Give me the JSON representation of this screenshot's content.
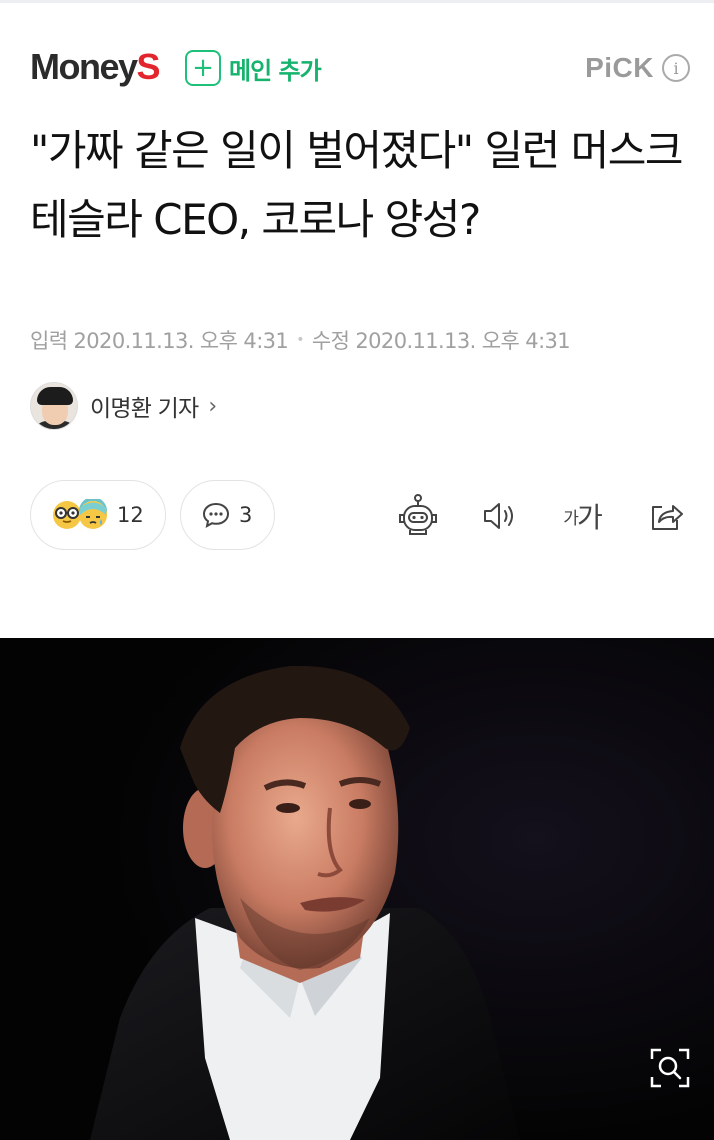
{
  "header": {
    "press_name_main": "Money",
    "press_name_accent": "S",
    "subscribe_label": "메인 추가",
    "subscribe_icon": "plus-icon",
    "pick_label": "PiCK",
    "pick_info_symbol": "i",
    "accent_color": "#1ec07a",
    "brand_color": "#e3262d"
  },
  "article": {
    "headline": "\"가짜 같은 일이 벌어졌다\" 일런 머스크 테슬라 CEO, 코로나 양성?",
    "input_label": "입력",
    "input_datetime": "2020.11.13. 오후 4:31",
    "modified_label": "수정",
    "modified_datetime": "2020.11.13. 오후 4:31",
    "meta_separator": "•"
  },
  "reporter": {
    "name": "이명환 기자",
    "chevron": "›"
  },
  "actions": {
    "reaction_count": "12",
    "reaction_icons": [
      "glasses-face-icon",
      "sick-face-icon"
    ],
    "comment_count": "3",
    "comment_icon": "speech-bubble-icon",
    "summary_icon": "robot-icon",
    "tts_icon": "speaker-icon",
    "font_size_small": "가",
    "font_size_large": "가",
    "share_icon": "share-icon"
  },
  "photo": {
    "zoom_icon": "zoom-icon"
  }
}
